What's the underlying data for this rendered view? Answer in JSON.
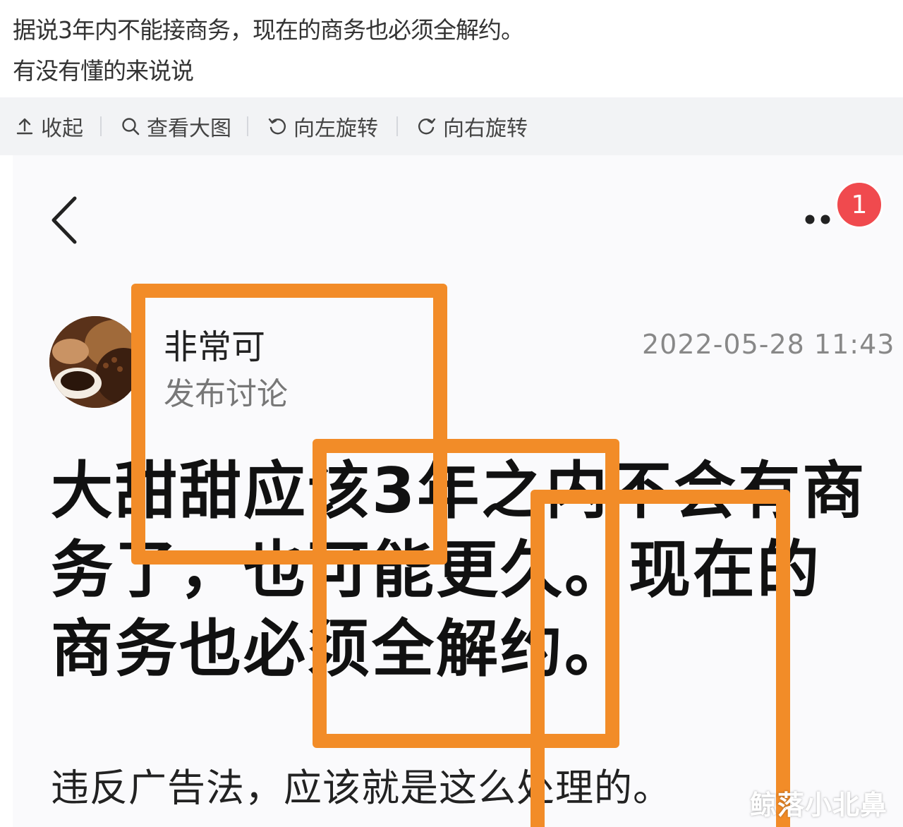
{
  "question": {
    "line1": "据说3年内不能接商务，现在的商务也必须全解约。",
    "line2": "有没有懂的来说说"
  },
  "toolbar": {
    "collapse_label": "收起",
    "view_large_label": "查看大图",
    "rotate_left_label": "向左旋转",
    "rotate_right_label": "向右旋转"
  },
  "post": {
    "badge_count": "1",
    "author_name": "非常可",
    "author_action": "发布讨论",
    "timestamp": "2022-05-28 11:43",
    "headline": "大甜甜应该3年之内不会有商务了，也可能更久。现在的商务也必须全解约。",
    "body": "违反广告法，应该就是这么处理的。"
  },
  "watermark": "鲸落小北鼻",
  "colors": {
    "highlight": "#f28c28",
    "badge": "#f04a4e",
    "toolbar_bg": "#f2f3f5"
  },
  "icons": [
    "collapse-icon",
    "search-icon",
    "rotate-left-icon",
    "rotate-right-icon",
    "back-arrow-icon",
    "more-dots-icon"
  ]
}
